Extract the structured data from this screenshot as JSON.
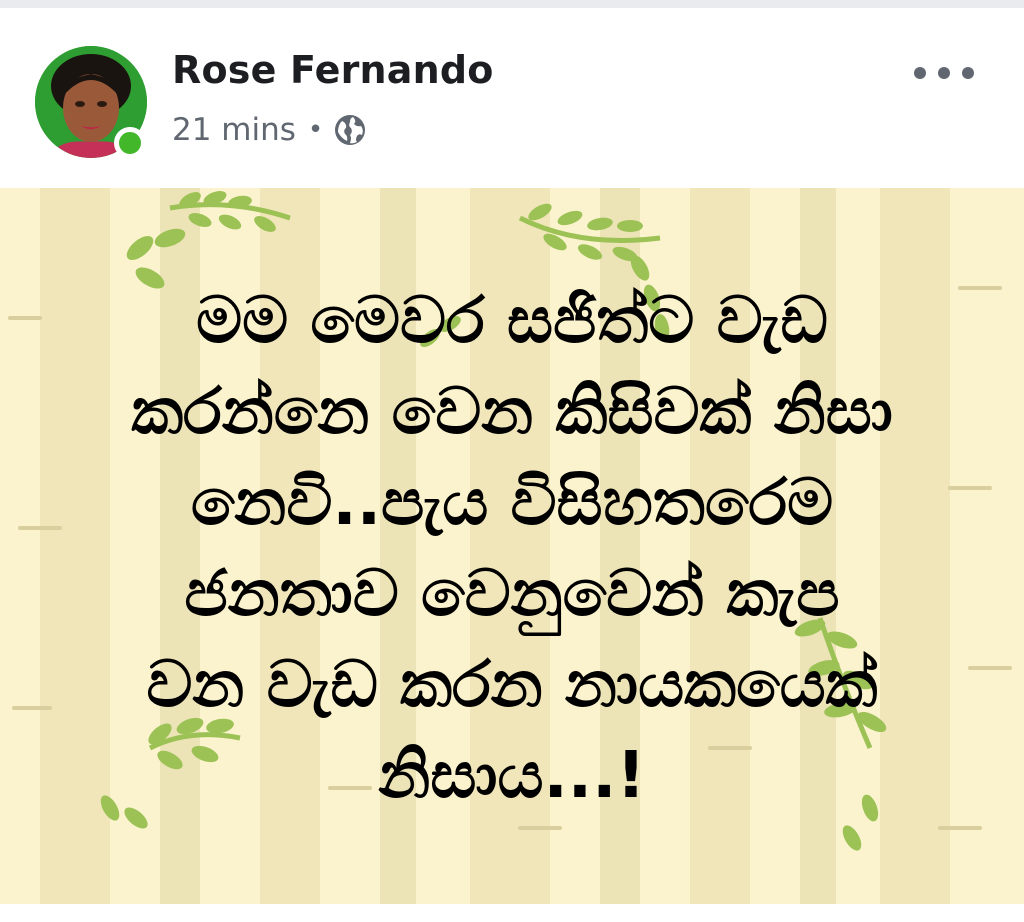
{
  "post": {
    "author": "Rose Fernando",
    "time": "21 mins",
    "separator": "•",
    "privacy_icon": "globe-icon",
    "more_icon": "more-horizontal-icon",
    "online_status_color": "#42b72a"
  },
  "image": {
    "background_color": "#fbf3cd",
    "leaf_color": "#8db84a",
    "lines": [
      "මම මෙවර සජිත්ට වැඩ",
      "කරන්නෙ වෙන කිසිවක් නිසා",
      "නෙවි..පැය විසිහතරෙම",
      "ජනතාව වෙනුවෙන් කැප",
      "වන වැඩ කරන නායකයෙක්",
      "නිසාය...!"
    ]
  }
}
